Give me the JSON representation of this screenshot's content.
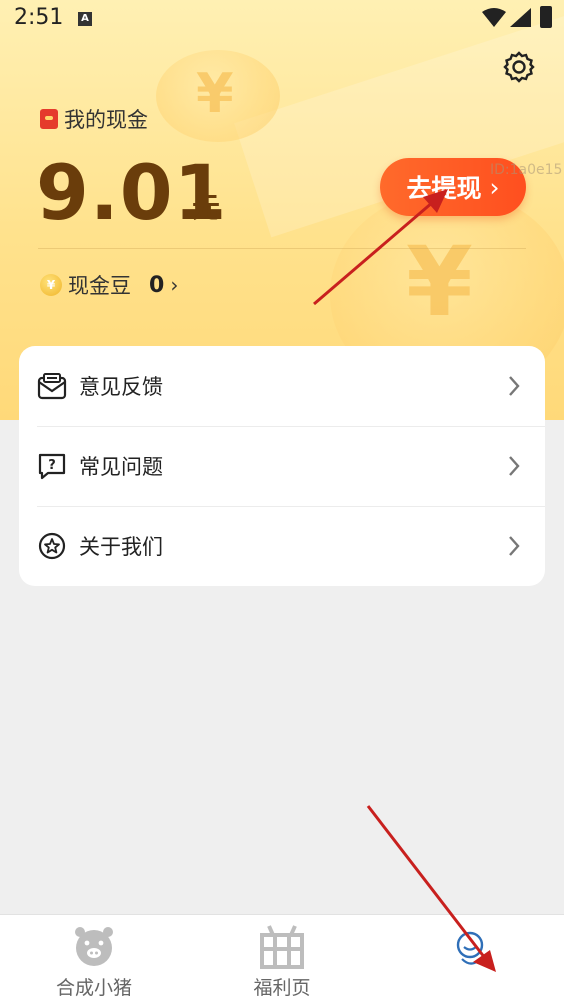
{
  "status_bar": {
    "time": "2:51",
    "notification_badge": "A"
  },
  "wallet": {
    "title": "我的现金",
    "amount": "9.01",
    "unit": "元",
    "withdraw_label": "去提现",
    "withdraw_chevron": "›",
    "watermark": "ID:1a0e15",
    "beans_label": "现金豆",
    "beans_value": "0",
    "beans_chevron": "›",
    "bean_icon_glyph": "¥"
  },
  "menu": {
    "items": [
      {
        "label": "意见反馈",
        "icon": "feedback-icon"
      },
      {
        "label": "常见问题",
        "icon": "faq-icon"
      },
      {
        "label": "关于我们",
        "icon": "about-icon"
      }
    ]
  },
  "tabbar": {
    "tabs": [
      {
        "label": "合成小猪",
        "icon": "pig-icon"
      },
      {
        "label": "福利页",
        "icon": "gift-icon"
      },
      {
        "label": "",
        "icon": "profile-icon"
      }
    ]
  },
  "colors": {
    "accent": "#ff5a24",
    "amount_text": "#6a3d0b",
    "header_bg": "#ffe28d",
    "annotation_arrow": "#c8201e"
  }
}
